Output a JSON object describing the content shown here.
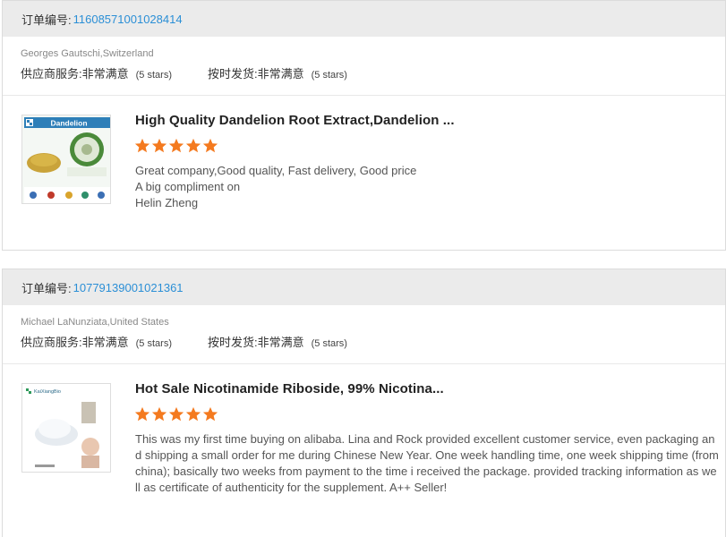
{
  "order_label": "订单编号:",
  "rating_texts": {
    "service_label": "供应商服务:",
    "shipping_label": "按时发货:",
    "value": "非常满意",
    "stars_note": "(5 stars)"
  },
  "colors": {
    "accent": "#2b8fd6",
    "star": "#f47a1f",
    "header_bg": "#ebebeb"
  },
  "orders": [
    {
      "order_number": "11608571001028414",
      "buyer": "Georges Gautschi,Switzerland",
      "product_title": "High Quality Dandelion Root Extract,Dandelion ...",
      "thumb_label": "Dandelion",
      "star_rating": 5,
      "review_lines": [
        "Great company,Good quality, Fast delivery, Good price",
        "A big compliment on",
        "Helin Zheng"
      ]
    },
    {
      "order_number": "10779139001021361",
      "buyer": "Michael LaNunziata,United States",
      "product_title": "Hot Sale Nicotinamide Riboside, 99% Nicotina...",
      "thumb_label": "KaiXiangBio",
      "star_rating": 5,
      "review": "This was my first time buying on alibaba.  Lina and Rock provided excellent customer service, even packaging and shipping a small order for me during Chinese New Year. One week handling time, one week shipping time (from china); basically two weeks from payment to the time i received the package.  provided tracking information as well as certificate of authenticity for the supplement. A++ Seller!"
    }
  ]
}
